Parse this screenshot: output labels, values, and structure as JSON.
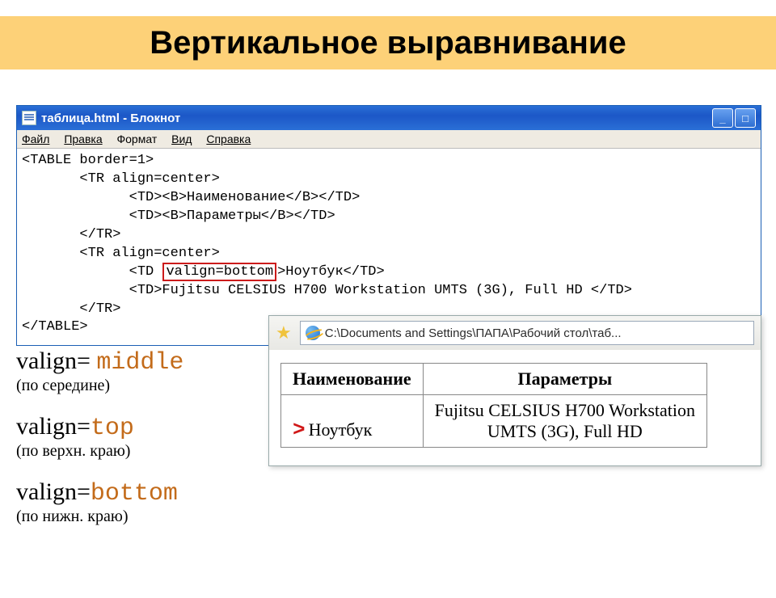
{
  "slide_title": "Вертикальное выравнивание",
  "notepad": {
    "title": "таблица.html - Блокнот",
    "menus": [
      "Файл",
      "Правка",
      "Формат",
      "Вид",
      "Справка"
    ],
    "win_buttons": {
      "min": "_",
      "max": "□",
      "close": "×"
    },
    "code": {
      "l1": "<TABLE border=1>",
      "l2": "       <TR align=center>",
      "l3": "             <TD><B>Наименование</B></TD>",
      "l4": "             <TD><B>Параметры</B></TD>",
      "l5": "       </TR>",
      "l6": "       <TR align=center>",
      "l7a": "             <TD ",
      "l7_box": "valign=bottom",
      "l7b": ">Ноутбук</TD>",
      "l8": "             <TD>Fujitsu CELSIUS H700 Workstation UMTS (3G), Full HD </TD>",
      "l9": "       </TR>",
      "l10": "</TABLE>"
    }
  },
  "legend": [
    {
      "attr": "valign= ",
      "value": "middle",
      "sub": "(по середине)"
    },
    {
      "attr": "valign=",
      "value": "top",
      "sub": "(по верхн. краю)"
    },
    {
      "attr": "valign=",
      "value": "bottom",
      "sub": "(по нижн. краю)"
    }
  ],
  "ie": {
    "path": "C:\\Documents and Settings\\ПАПА\\Рабочий стол\\таб...",
    "table": {
      "head": [
        "Наименование",
        "Параметры"
      ],
      "row": {
        "marker": ">",
        "c1": "Ноутбук",
        "c2a": "Fujitsu CELSIUS H700 Workstation",
        "c2b": "UMTS (3G), Full HD"
      }
    }
  }
}
